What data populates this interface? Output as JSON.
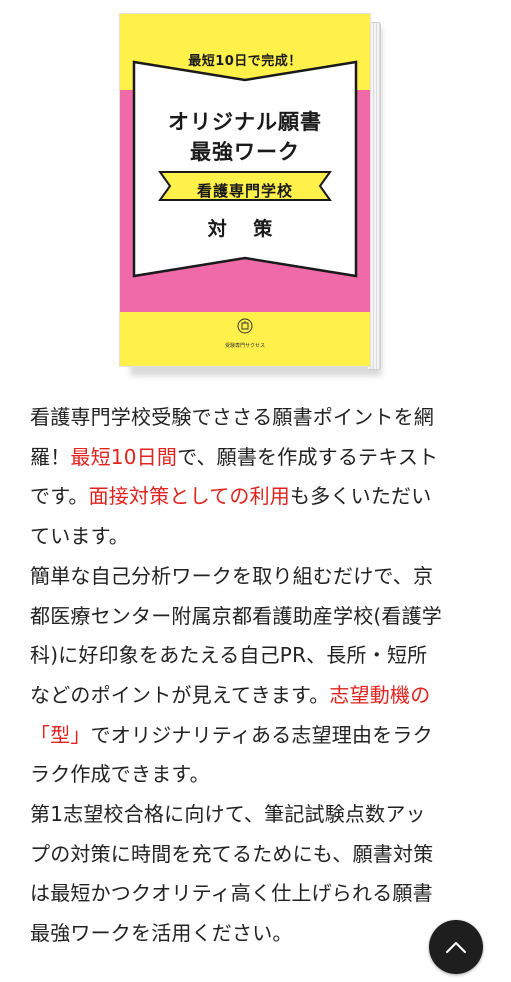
{
  "book": {
    "catch": "最短10日で完成！",
    "title_line1": "オリジナル願書",
    "title_line2": "最強ワーク",
    "subtitle": "看護専門学校",
    "taisaku": "対 策",
    "publisher": "受験専門サクセス",
    "colors": {
      "pink": "#f06aa9",
      "yellow": "#fff04a"
    }
  },
  "body": {
    "l1": "看護専門学校受験でささる願書ポイントを網",
    "l2_a": "羅！",
    "l2_b": "最短10日間",
    "l2_c": "で、願書を作成するテキスト",
    "l3_a": "です。",
    "l3_b": "面接対策としての利用",
    "l3_c": "も多くいただい",
    "l4": "ています。",
    "l5": "簡単な自己分析ワークを取り組むだけで、京",
    "l6": "都医療センター附属京都看護助産学校(看護学",
    "l7": "科)に好印象をあたえる自己PR、長所・短所",
    "l8_a": "などのポイントが見えてきます。",
    "l8_b": "志望動機の",
    "l9_a": "「型」",
    "l9_b": "でオリジナリティある志望理由をラク",
    "l10": "ラク作成できます。",
    "l11": "第1志望校合格に向けて、筆記試験点数アッ",
    "l12": "プの対策に時間を充てるためにも、願書対策",
    "l13": "は最短かつクオリティ高く仕上げられる願書",
    "l14": "最強ワークを活用ください。",
    "highlight_color": "#e0231e"
  },
  "ui": {
    "to_top_icon": "chevron-up-icon"
  }
}
